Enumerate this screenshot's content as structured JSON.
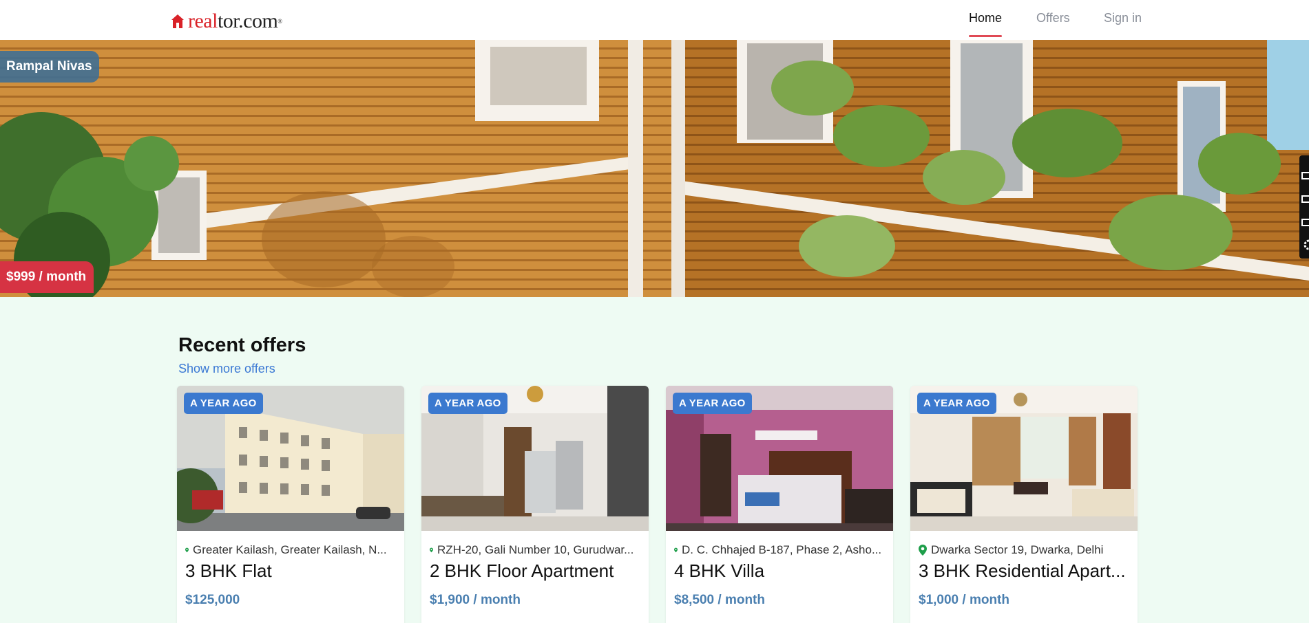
{
  "header": {
    "logo": {
      "part1": "real",
      "part2": "tor.com",
      "mark": "®"
    },
    "nav": [
      {
        "label": "Home",
        "active": true
      },
      {
        "label": "Offers",
        "active": false
      },
      {
        "label": "Sign in",
        "active": false
      }
    ]
  },
  "hero": {
    "property_name": "Rampal Nivas",
    "price": "$999 / month"
  },
  "offers": {
    "title": "Recent offers",
    "show_more": "Show more offers",
    "cards": [
      {
        "badge": "A YEAR AGO",
        "location": "Greater Kailash, Greater Kailash, N...",
        "title": "3 BHK Flat",
        "price": "$125,000"
      },
      {
        "badge": "A YEAR AGO",
        "location": "RZH-20, Gali Number 10, Gurudwar...",
        "title": "2 BHK Floor Apartment",
        "price": "$1,900 / month"
      },
      {
        "badge": "A YEAR AGO",
        "location": "D. C. Chhajed B-187, Phase 2, Asho...",
        "title": "4 BHK Villa",
        "price": "$8,500 / month"
      },
      {
        "badge": "A YEAR AGO",
        "location": "Dwarka Sector 19, Dwarka, Delhi",
        "title": "3 BHK Residential Apart...",
        "price": "$1,000 / month"
      }
    ]
  },
  "colors": {
    "brand_red": "#d92228",
    "accent_blue": "#3b79cf",
    "page_bg": "#eefbf3",
    "pin_green": "#1e9e4a"
  },
  "icons": [
    "home-logo-icon",
    "location-pin-icon",
    "gear-icon"
  ]
}
